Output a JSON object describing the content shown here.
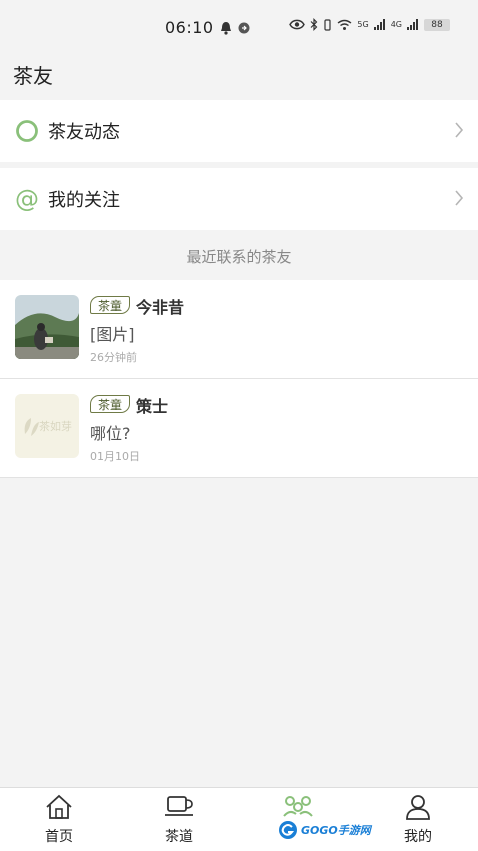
{
  "status_bar": {
    "time": "06:10",
    "battery": "88",
    "signal_1": "5G",
    "signal_2": "4G"
  },
  "header": {
    "title": "茶友"
  },
  "menu": {
    "moments_label": "茶友动态",
    "following_label": "我的关注"
  },
  "recent": {
    "section_title": "最近联系的茶友",
    "contacts": [
      {
        "tag": "茶童",
        "name": "今非昔",
        "message": "[图片]",
        "time": "26分钟前"
      },
      {
        "tag": "茶童",
        "name": "策士",
        "message": "哪位?",
        "time": "01月10日",
        "avatar_text": "茶如芽"
      }
    ]
  },
  "tabbar": {
    "items": [
      {
        "label": "首页",
        "icon": "home-icon"
      },
      {
        "label": "茶道",
        "icon": "tea-cup-icon"
      },
      {
        "label": "",
        "icon": "tea-friends-icon",
        "active": true
      },
      {
        "label": "我的",
        "icon": "user-icon"
      }
    ]
  },
  "watermark": {
    "text": "GOGO手游网"
  },
  "colors": {
    "accent_green": "#8ac07a",
    "tag_border": "#6f7a46",
    "background": "#f3f3f3"
  }
}
